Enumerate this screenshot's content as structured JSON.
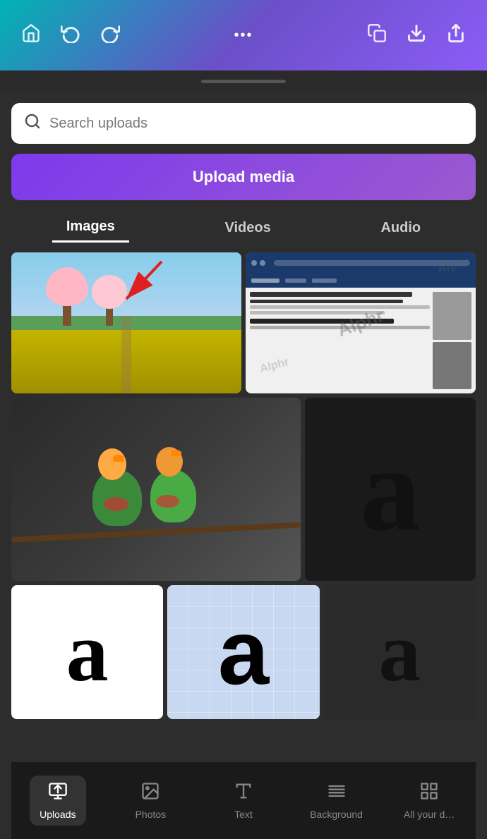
{
  "topbar": {
    "home_icon": "🏠",
    "undo_icon": "↩",
    "redo_icon": "↪",
    "more_icon": "•••",
    "copy_icon": "❐",
    "download_icon": "⬇",
    "share_icon": "⬆"
  },
  "search": {
    "placeholder": "Search uploads"
  },
  "upload_button": {
    "label": "Upload media"
  },
  "tabs": [
    {
      "id": "images",
      "label": "Images",
      "active": true
    },
    {
      "id": "videos",
      "label": "Videos",
      "active": false
    },
    {
      "id": "audio",
      "label": "Audio",
      "active": false
    }
  ],
  "bottom_nav": [
    {
      "id": "uploads",
      "label": "Uploads",
      "active": true
    },
    {
      "id": "photos",
      "label": "Photos",
      "active": false
    },
    {
      "id": "text",
      "label": "Text",
      "active": false
    },
    {
      "id": "background",
      "label": "Background",
      "active": false
    },
    {
      "id": "allyour",
      "label": "All your d…",
      "active": false
    }
  ],
  "grid": {
    "row1": [
      {
        "type": "spring-landscape",
        "alt": "Spring cherry blossom field"
      },
      {
        "type": "article-screenshot",
        "alt": "Alphr article screenshot"
      }
    ],
    "row2": [
      {
        "type": "birds",
        "alt": "Two lovebirds on branch"
      },
      {
        "type": "letter-a-dark",
        "letter": "a"
      }
    ],
    "row3": [
      {
        "type": "letter-a-white",
        "letter": "a"
      },
      {
        "type": "letter-a-blue",
        "letter": "a"
      },
      {
        "type": "letter-a-dark2",
        "letter": "a"
      }
    ]
  },
  "colors": {
    "accent_purple": "#7c3aed",
    "background_dark": "#2d2d2d",
    "tab_active": "#ffffff",
    "tab_inactive": "#cccccc"
  }
}
